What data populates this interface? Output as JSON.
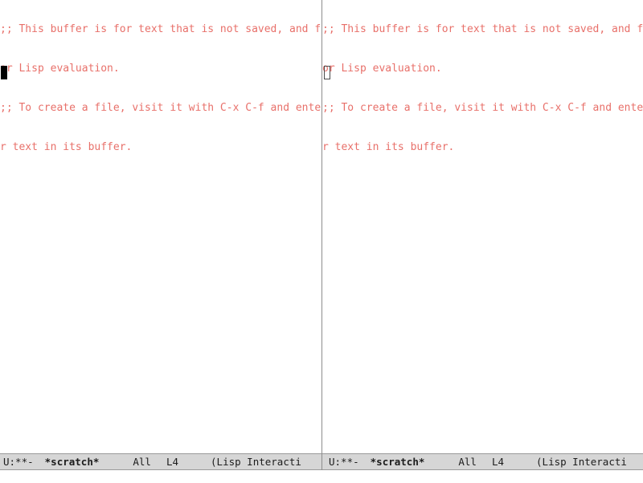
{
  "frame": {
    "background_color": "#ffffff",
    "divider_color": "#8d8d8d"
  },
  "buffer": {
    "name": "*scratch*",
    "comment_color": "#e8706a",
    "lines": [
      ";; This buffer is for text that is not saved, and for Lisp evaluation.",
      ";; To create a file, visit it with C-x C-f and enter text in its buffer."
    ],
    "visual_lines": [
      ";; This buffer is for text that is not saved, and f",
      "or Lisp evaluation.",
      ";; To create a file, visit it with C-x C-f and ente",
      "r text in its buffer."
    ]
  },
  "windows": [
    {
      "id": "left",
      "active": true,
      "cursor_style": "filled-block",
      "mode_line": {
        "status": "U:**-",
        "buffer_name": "*scratch*",
        "position": "All",
        "line": "L4",
        "major_mode": "(Lisp Interacti",
        "full_text": "U:**-  *scratch*      All   L4     (Lisp Interacti",
        "background_color": "#d6d6d6",
        "text_color": "#1c1c1c"
      }
    },
    {
      "id": "right",
      "active": false,
      "cursor_style": "hollow-block",
      "mode_line": {
        "status": "U:**-",
        "buffer_name": "*scratch*",
        "position": "All",
        "line": "L4",
        "major_mode": "(Lisp Interacti",
        "full_text": "U:**-  *scratch*      All   L4     (Lisp Interacti",
        "background_color": "#d6d6d6",
        "text_color": "#1c1c1c"
      }
    }
  ],
  "echo_area": {
    "text": ""
  }
}
